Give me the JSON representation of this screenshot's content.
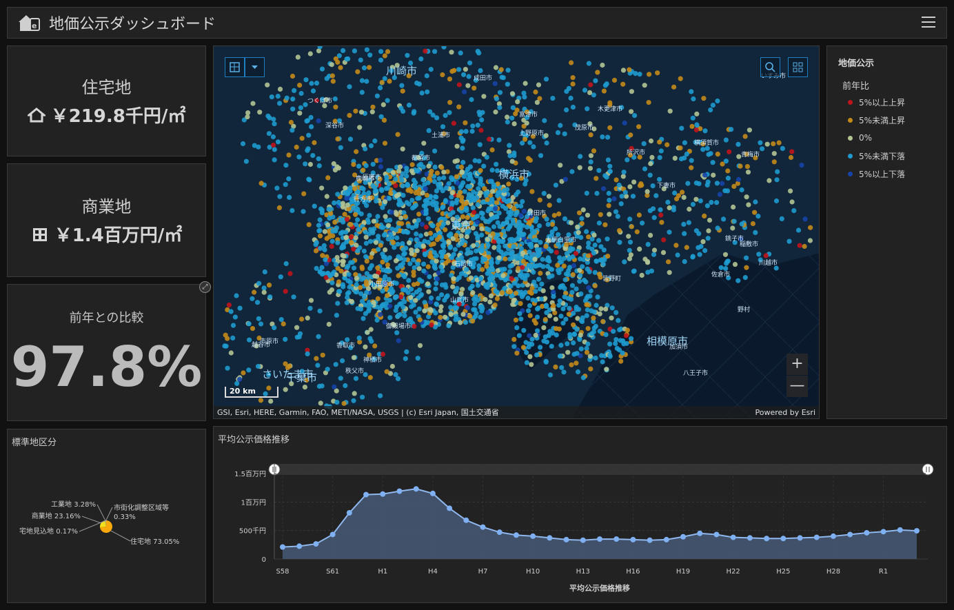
{
  "header": {
    "title": "地価公示ダッシュボード"
  },
  "residential": {
    "label": "住宅地",
    "value": "￥219.8千円/㎡"
  },
  "commercial": {
    "label": "商業地",
    "value": "￥1.4百万円/㎡"
  },
  "comparison": {
    "label": "前年との比較",
    "value": "97.8%"
  },
  "map": {
    "attribution": "GSI, Esri, HERE, Garmin, FAO, METI/NASA, USGS | (c) Esri Japan, 国土交通省",
    "powered": "Powered by Esri",
    "scale": "20 km",
    "zoom_in": "+",
    "zoom_out": "—",
    "place_labels": [
      "深谷市",
      "加須市",
      "下妻市",
      "石岡市",
      "鉾田市",
      "つくば市",
      "土浦市",
      "行方市",
      "鹿嶋市",
      "稲敷市",
      "神栖市",
      "香取市",
      "さいたま市",
      "川越市",
      "越谷市",
      "所沢市",
      "青梅市",
      "東京",
      "八王子市",
      "相模原市",
      "川崎市",
      "横浜市",
      "千葉市",
      "市原市",
      "木更津市",
      "茂原市",
      "いすみ市",
      "匝瑳市",
      "銚子市",
      "山武市",
      "大網白里市",
      "小田原市",
      "御殿場市",
      "上野原市",
      "秩父市",
      "皆野町",
      "野村",
      "都留市",
      "横須賀市",
      "富津市",
      "成田市",
      "佐倉市"
    ]
  },
  "legend": {
    "title": "地価公示",
    "subtitle": "前年比",
    "items": [
      {
        "label": "5%以上上昇",
        "color": "#c0141c"
      },
      {
        "label": "5%未満上昇",
        "color": "#c38a1a"
      },
      {
        "label": "0%",
        "color": "#b3c493"
      },
      {
        "label": "5%未満下落",
        "color": "#1e9bcf"
      },
      {
        "label": "5%以上下落",
        "color": "#1744a8"
      }
    ]
  },
  "pie": {
    "title": "標準地区分",
    "slices": [
      {
        "label": "住宅地 73.05%",
        "value": 73.05,
        "color": "#f7a80a"
      },
      {
        "label": "商業地 23.16%",
        "value": 23.16,
        "color": "#f3df1b"
      },
      {
        "label": "工業地 3.28%",
        "value": 3.28,
        "color": "#d8c75e"
      },
      {
        "label": "市街化調整区域等 0.33%",
        "value": 0.33,
        "color": "#9bbf5a"
      },
      {
        "label": "宅地見込地 0.17%",
        "value": 0.17,
        "color": "#6fa25a"
      }
    ]
  },
  "chart_data": {
    "type": "area",
    "title": "平均公示価格推移",
    "xlabel": "平均公示価格推移",
    "ylabel": "",
    "ylim": [
      0,
      1500000
    ],
    "yticks": [
      {
        "value": 0,
        "label": "0"
      },
      {
        "value": 500000,
        "label": "500千円"
      },
      {
        "value": 1000000,
        "label": "1百万円"
      },
      {
        "value": 1500000,
        "label": "1.5百万円"
      }
    ],
    "x_tick_labels": [
      "S58",
      "S61",
      "H1",
      "H4",
      "H7",
      "H10",
      "H13",
      "H16",
      "H19",
      "H22",
      "H25",
      "H28",
      "R1"
    ],
    "x": [
      "S58",
      "S59",
      "S60",
      "S61",
      "S62",
      "S63",
      "H1",
      "H2",
      "H3",
      "H4",
      "H5",
      "H6",
      "H7",
      "H8",
      "H9",
      "H10",
      "H11",
      "H12",
      "H13",
      "H14",
      "H15",
      "H16",
      "H17",
      "H18",
      "H19",
      "H20",
      "H21",
      "H22",
      "H23",
      "H24",
      "H25",
      "H26",
      "H27",
      "H28",
      "H29",
      "H30",
      "R1",
      "R2",
      "R3"
    ],
    "series": [
      {
        "values": [
          210000,
          225000,
          265000,
          430000,
          810000,
          1130000,
          1140000,
          1190000,
          1230000,
          1150000,
          890000,
          680000,
          560000,
          470000,
          420000,
          400000,
          370000,
          340000,
          330000,
          350000,
          350000,
          340000,
          330000,
          340000,
          390000,
          450000,
          430000,
          380000,
          370000,
          360000,
          360000,
          370000,
          380000,
          400000,
          430000,
          460000,
          480000,
          510000,
          495000
        ]
      }
    ]
  }
}
